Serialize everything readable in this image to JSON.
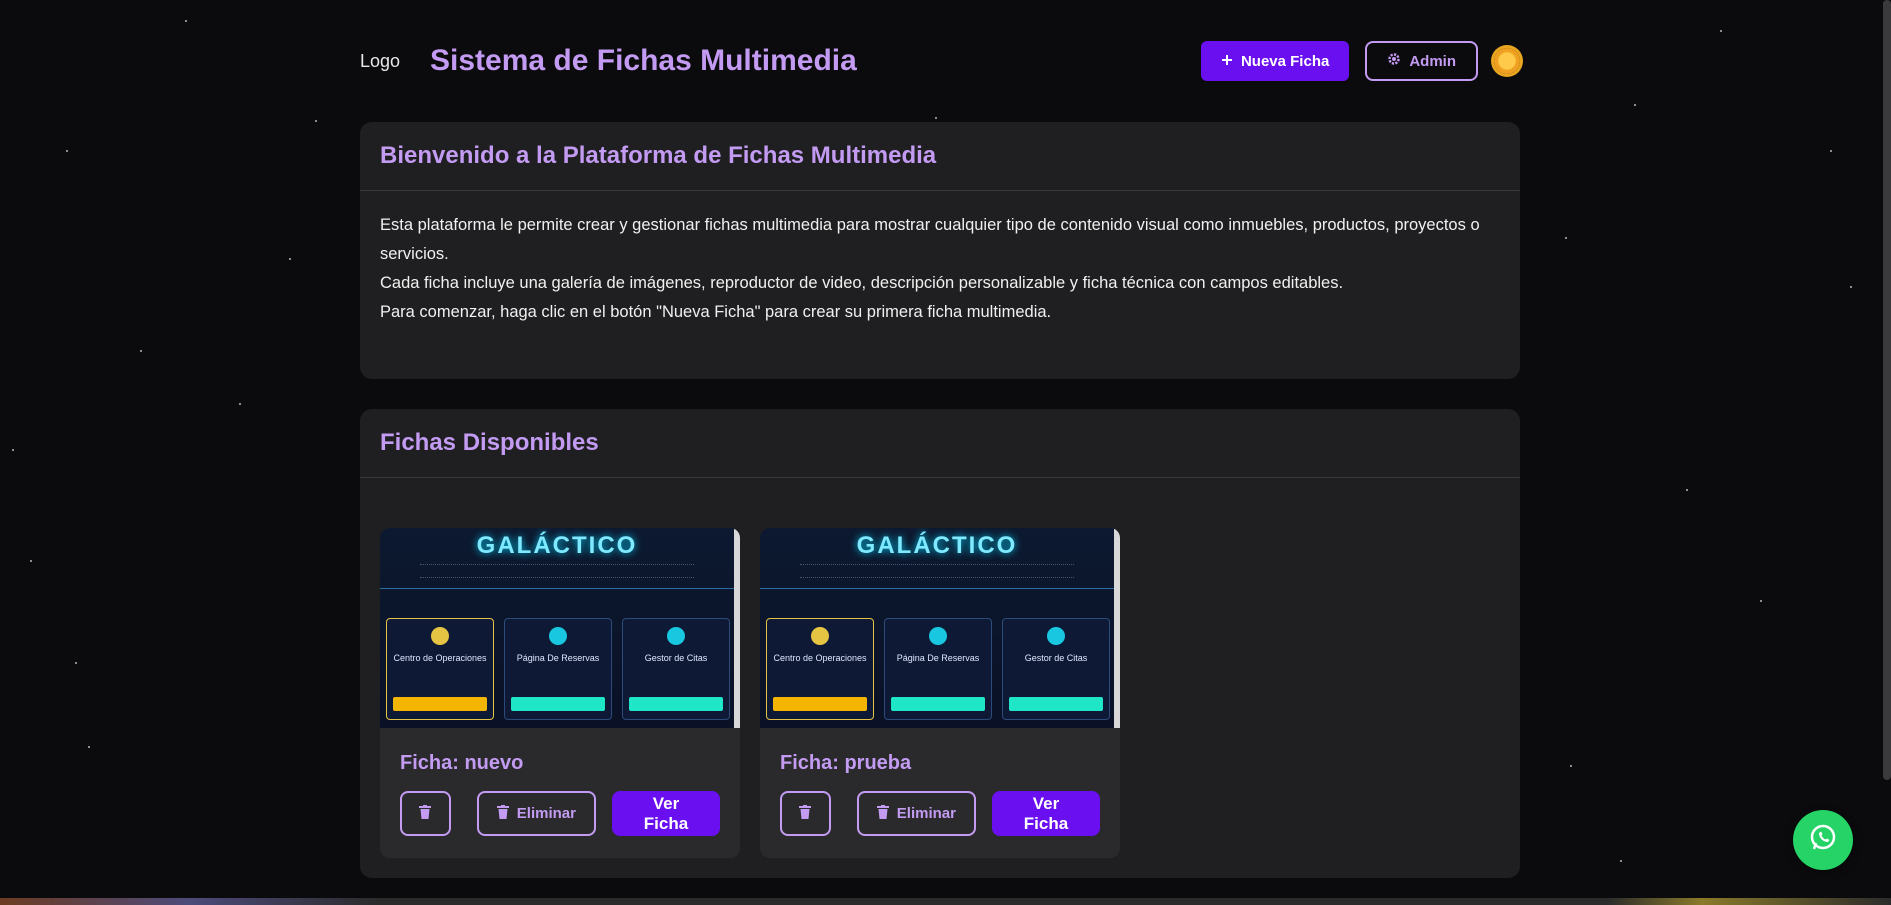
{
  "header": {
    "logo_alt": "Logo",
    "title": "Sistema de Fichas Multimedia",
    "new_button": "Nueva Ficha",
    "admin_button": "Admin"
  },
  "welcome": {
    "title": "Bienvenido a la Plataforma de Fichas Multimedia",
    "paragraphs": [
      "Esta plataforma le permite crear y gestionar fichas multimedia para mostrar cualquier tipo de contenido visual como inmuebles, productos, proyectos o servicios.",
      "Cada ficha incluye una galería de imágenes, reproductor de video, descripción personalizable y ficha técnica con campos editables.",
      "Para comenzar, haga clic en el botón \"Nueva Ficha\" para crear su primera ficha multimedia."
    ]
  },
  "fichas": {
    "title": "Fichas Disponibles",
    "items": [
      {
        "name": "Ficha: nuevo",
        "delete_label": "Eliminar",
        "view_label": "Ver Ficha"
      },
      {
        "name": "Ficha: prueba",
        "delete_label": "Eliminar",
        "view_label": "Ver Ficha"
      }
    ],
    "thumbnail": {
      "title": "GALÁCTICO",
      "panels": [
        "Centro de Operaciones",
        "Página De Reservas",
        "Gestor de Citas"
      ]
    }
  },
  "colors": {
    "accent": "#c39bf2",
    "primary": "#6a10f0",
    "whatsapp": "#25d366"
  },
  "icons": {
    "plus": "plus-icon",
    "gear": "gear-icon",
    "sun": "sun-icon",
    "trash": "trash-icon",
    "whatsapp": "whatsapp-icon"
  }
}
